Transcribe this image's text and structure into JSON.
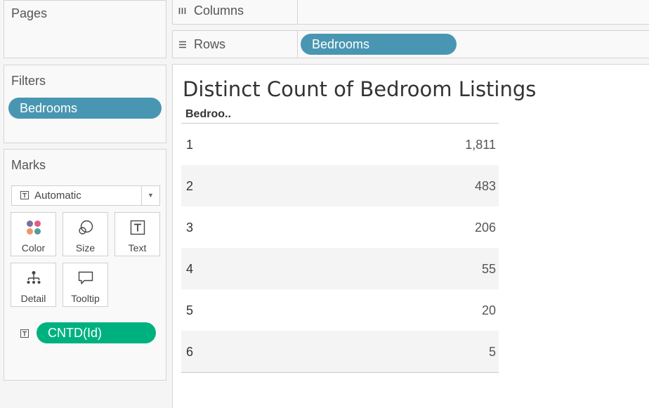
{
  "pages_card": {
    "title": "Pages"
  },
  "filters_card": {
    "title": "Filters",
    "pills": [
      {
        "label": "Bedrooms"
      }
    ]
  },
  "marks_card": {
    "title": "Marks",
    "mark_type": "Automatic",
    "buttons": [
      {
        "label": "Color"
      },
      {
        "label": "Size"
      },
      {
        "label": "Text"
      },
      {
        "label": "Detail"
      },
      {
        "label": "Tooltip"
      }
    ],
    "field_pill": {
      "label": "CNTD(Id)"
    }
  },
  "shelves": {
    "columns": {
      "label": "Columns"
    },
    "rows": {
      "label": "Rows",
      "pills": [
        {
          "label": "Bedrooms"
        }
      ]
    }
  },
  "viz": {
    "title": "Distinct Count of Bedroom Listings",
    "column_header": "Bedroo..",
    "rows": [
      {
        "category": "1",
        "value": "1,811"
      },
      {
        "category": "2",
        "value": "483"
      },
      {
        "category": "3",
        "value": "206"
      },
      {
        "category": "4",
        "value": "55"
      },
      {
        "category": "5",
        "value": "20"
      },
      {
        "category": "6",
        "value": "5"
      }
    ]
  },
  "colors": {
    "dimension_pill": "#4996b2",
    "measure_pill": "#00b180",
    "color_dots": [
      "#7b6f9c",
      "#e0607e",
      "#f0956b",
      "#4e9f9d"
    ]
  }
}
